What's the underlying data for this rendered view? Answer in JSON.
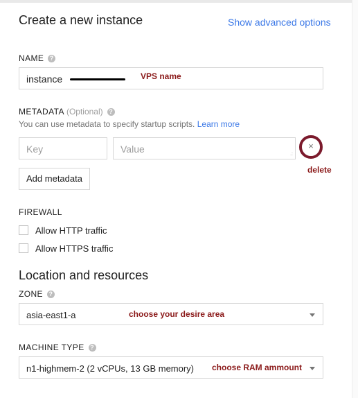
{
  "header": {
    "title": "Create a new instance",
    "advanced_link": "Show advanced options"
  },
  "name_section": {
    "label": "NAME",
    "value": "instance",
    "annotation": "VPS name"
  },
  "metadata": {
    "label": "METADATA",
    "optional": "(Optional)",
    "description": "You can use metadata to specify startup scripts.",
    "learn_more": "Learn more",
    "key_placeholder": "Key",
    "value_placeholder": "Value",
    "delete_glyph": "×",
    "delete_annotation": "delete",
    "add_button": "Add metadata"
  },
  "firewall": {
    "label": "FIREWALL",
    "options": [
      {
        "label": "Allow HTTP traffic",
        "checked": false
      },
      {
        "label": "Allow HTTPS traffic",
        "checked": false
      }
    ]
  },
  "location": {
    "heading": "Location and resources",
    "zone_label": "ZONE",
    "zone_value": "asia-east1-a",
    "zone_annotation": "choose your desire area",
    "machine_label": "MACHINE TYPE",
    "machine_value": "n1-highmem-2 (2 vCPUs, 13 GB memory)",
    "machine_annotation": "choose RAM ammount"
  },
  "icons": {
    "help": "help-icon",
    "delete": "close-icon",
    "dropdown": "dropdown-arrow-icon",
    "resize": "resize-handle-icon"
  },
  "colors": {
    "link": "#3b78e7",
    "annotation": "#8b1a1a",
    "delete_circle": "#7b1a2c",
    "border": "#d6d6d6",
    "muted": "#757575"
  }
}
